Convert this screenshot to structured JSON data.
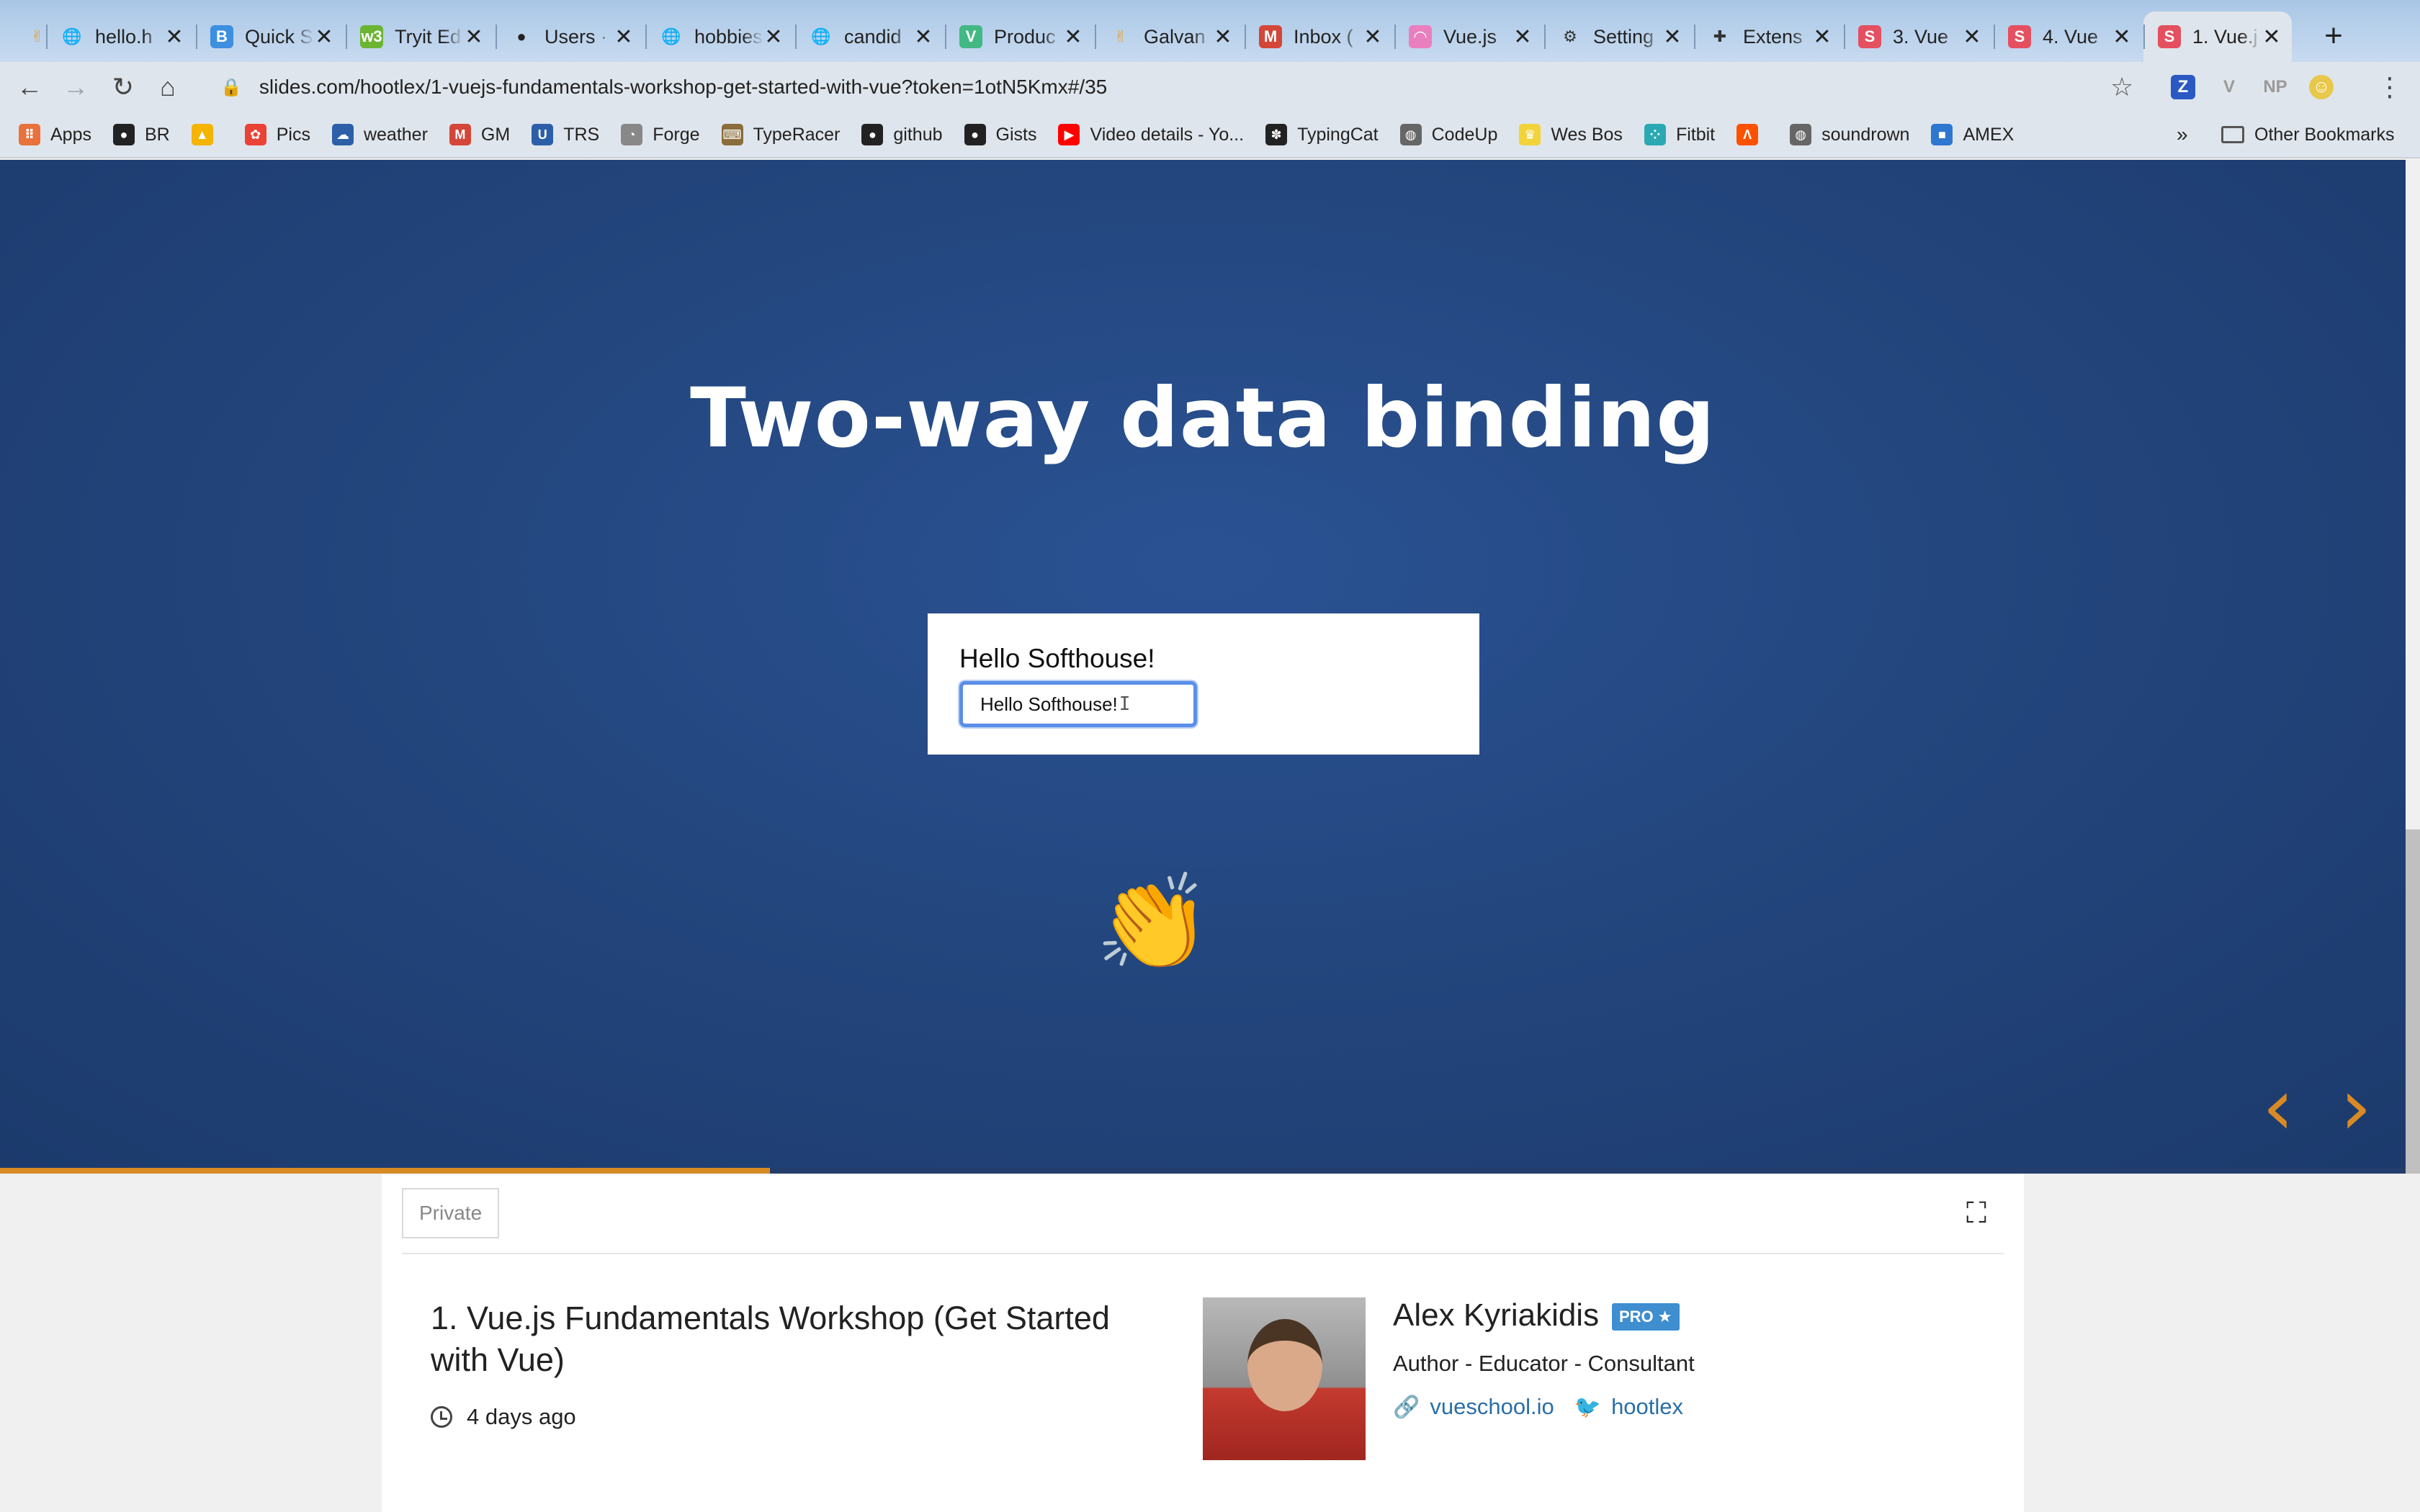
{
  "browser": {
    "tabs": [
      {
        "icon": "hand-icon",
        "fav": "✌",
        "color": "#e8a33d",
        "title": "",
        "active": false
      },
      {
        "icon": "globe-icon",
        "fav": "🌐",
        "color": "transparent",
        "title": "hello.h",
        "active": false
      },
      {
        "icon": "bootstrap-icon",
        "fav": "B",
        "color": "#3d8fe0",
        "title": "Quick S",
        "active": false
      },
      {
        "icon": "w3-icon",
        "fav": "w3",
        "color": "#6cb533",
        "title": "Tryit Ed",
        "active": false
      },
      {
        "icon": "github-icon",
        "fav": "●",
        "color": "#222222",
        "title": "Users · ",
        "active": false
      },
      {
        "icon": "globe-icon",
        "fav": "🌐",
        "color": "transparent",
        "title": "hobbies",
        "active": false
      },
      {
        "icon": "globe-icon",
        "fav": "🌐",
        "color": "transparent",
        "title": "candid",
        "active": false
      },
      {
        "icon": "vue-icon",
        "fav": "V",
        "color": "#42b883",
        "title": "Produc",
        "active": false
      },
      {
        "icon": "hand-icon",
        "fav": "✌",
        "color": "#e8a33d",
        "title": "Galvan",
        "active": false
      },
      {
        "icon": "gmail-icon",
        "fav": "M",
        "color": "#d44638",
        "title": "Inbox (",
        "active": false
      },
      {
        "icon": "rainbow-icon",
        "fav": "◠",
        "color": "#e97fbf",
        "title": "Vue.js",
        "active": false
      },
      {
        "icon": "gear-icon",
        "fav": "⚙",
        "color": "transparent",
        "title": "Setting",
        "active": false
      },
      {
        "icon": "puzzle-icon",
        "fav": "✚",
        "color": "transparent",
        "title": "Extens",
        "active": false
      },
      {
        "icon": "slides-icon",
        "fav": "S",
        "color": "#e4505f",
        "title": "3. Vue",
        "active": false
      },
      {
        "icon": "slides-icon",
        "fav": "S",
        "color": "#e4505f",
        "title": "4. Vue",
        "active": false
      },
      {
        "icon": "slides-icon",
        "fav": "S",
        "color": "#e4505f",
        "title": "1. Vue.j",
        "active": true
      }
    ],
    "url": "slides.com/hootlex/1-vuejs-fundamentals-workshop-get-started-with-vue?token=1otN5Kmx#/35",
    "extensions": [
      {
        "name": "z-extension-icon",
        "glyph": "Z",
        "color": "#2b59c3"
      },
      {
        "name": "v-extension-icon",
        "glyph": "V",
        "color": "#9a9a9a"
      },
      {
        "name": "np-extension-icon",
        "glyph": "NP",
        "color": "#9a9a9a"
      },
      {
        "name": "profile-avatar-icon",
        "glyph": "☺",
        "color": "#e8c84a"
      }
    ],
    "bookmarks": [
      {
        "icon": "apps-grid-icon",
        "label": "Apps",
        "color": "#e8713c",
        "glyph": "⠿"
      },
      {
        "icon": "github-icon",
        "label": "BR",
        "color": "#222222",
        "glyph": "●"
      },
      {
        "icon": "google-drive-icon",
        "label": "",
        "color": "#f4b400",
        "glyph": "▲"
      },
      {
        "icon": "google-photos-icon",
        "label": "Pics",
        "color": "#ea4335",
        "glyph": "✿"
      },
      {
        "icon": "weather-icon",
        "label": "weather",
        "color": "#2c5fa8",
        "glyph": "☁"
      },
      {
        "icon": "gmail-icon",
        "label": "GM",
        "color": "#d44638",
        "glyph": "M"
      },
      {
        "icon": "uc-icon",
        "label": "TRS",
        "color": "#2c5fa8",
        "glyph": "U"
      },
      {
        "icon": "forge-icon",
        "label": "Forge",
        "color": "#888888",
        "glyph": "◔"
      },
      {
        "icon": "typeracer-icon",
        "label": "TypeRacer",
        "color": "#8a6d3b",
        "glyph": "⌨"
      },
      {
        "icon": "github-icon",
        "label": "github",
        "color": "#222222",
        "glyph": "●"
      },
      {
        "icon": "github-icon",
        "label": "Gists",
        "color": "#222222",
        "glyph": "●"
      },
      {
        "icon": "youtube-icon",
        "label": "Video details - Yo...",
        "color": "#ff0000",
        "glyph": "▶"
      },
      {
        "icon": "paw-icon",
        "label": "TypingCat",
        "color": "#222222",
        "glyph": "✽"
      },
      {
        "icon": "globe-icon",
        "label": "CodeUp",
        "color": "#666666",
        "glyph": "◍"
      },
      {
        "icon": "crown-icon",
        "label": "Wes Bos",
        "color": "#f2d43a",
        "glyph": "♛"
      },
      {
        "icon": "fitbit-icon",
        "label": "Fitbit",
        "color": "#2aa9b3",
        "glyph": "⁘"
      },
      {
        "icon": "strava-icon",
        "label": "",
        "color": "#fc5200",
        "glyph": "Λ"
      },
      {
        "icon": "globe-icon",
        "label": "soundrown",
        "color": "#666666",
        "glyph": "◍"
      },
      {
        "icon": "amex-icon",
        "label": "AMEX",
        "color": "#2e77d0",
        "glyph": "■"
      }
    ],
    "bookmarks_more": "»",
    "other_bookmarks": "Other Bookmarks"
  },
  "slide": {
    "title": "Two-way data binding",
    "demo_message": "Hello Softhouse!",
    "demo_input_value": "Hello Softhouse!",
    "emoji": "👏",
    "prev_arrow": "‹",
    "next_arrow": "›",
    "progress_fraction": 0.32
  },
  "deck": {
    "visibility": "Private",
    "title": "1. Vue.js Fundamentals Workshop (Get Started with Vue)",
    "time": "4 days ago",
    "author": {
      "name": "Alex Kyriakidis",
      "badge": "PRO ★",
      "role": "Author - Educator - Consultant",
      "website": "vueschool.io",
      "twitter": "hootlex"
    }
  },
  "colors": {
    "accent": "#d88a26",
    "slide_bg": "#23467e",
    "link": "#2a6ea8",
    "pro_badge": "#3e8ed0"
  }
}
